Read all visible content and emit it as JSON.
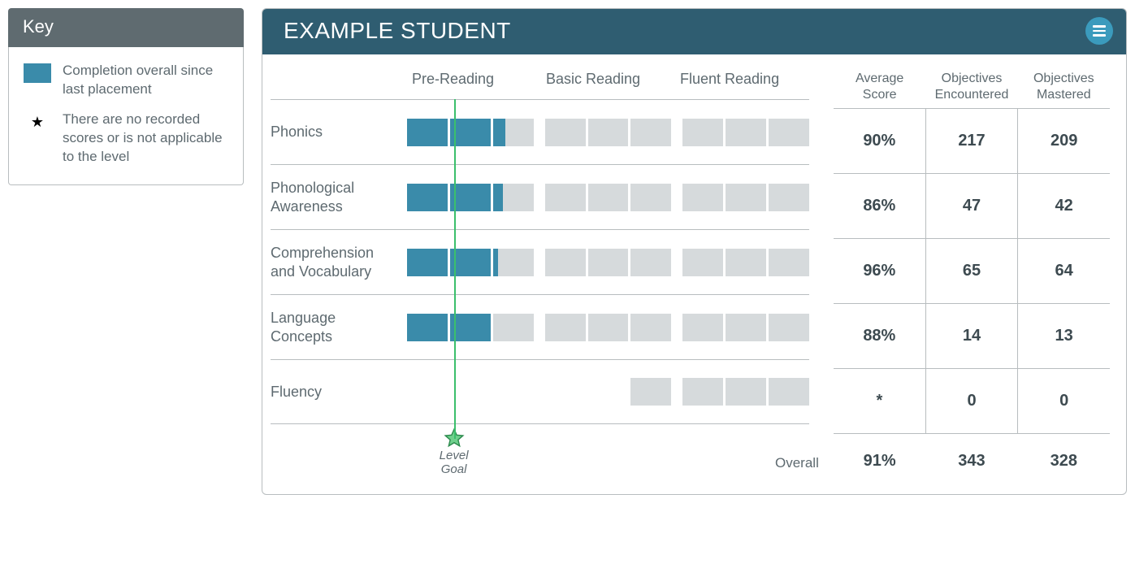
{
  "key": {
    "title": "Key",
    "swatch_text": "Completion overall since last placement",
    "star_text": "There are no recorded scores or is not applicable to the level"
  },
  "header": {
    "student": "EXAMPLE STUDENT"
  },
  "chart": {
    "columns": [
      "Pre-Reading",
      "Basic Reading",
      "Fluent Reading"
    ],
    "goal_label": "Level\nGoal"
  },
  "stats": {
    "headers": [
      "Average Score",
      "Objectives Encountered",
      "Objectives Mastered"
    ],
    "overall_label": "Overall",
    "overall": {
      "avg": "91%",
      "enc": "343",
      "mas": "328"
    }
  },
  "rows": [
    {
      "label": "Phonics",
      "avg": "90%",
      "enc": "217",
      "mas": "209",
      "groups": [
        [
          100,
          100,
          30
        ],
        [
          0,
          0,
          0
        ],
        [
          0,
          0,
          0
        ]
      ]
    },
    {
      "label": "Phonological Awareness",
      "avg": "86%",
      "enc": "47",
      "mas": "42",
      "groups": [
        [
          100,
          100,
          25
        ],
        [
          0,
          0,
          0
        ],
        [
          0,
          0,
          0
        ]
      ]
    },
    {
      "label": "Comprehension and Vocabulary",
      "avg": "96%",
      "enc": "65",
      "mas": "64",
      "groups": [
        [
          100,
          100,
          12
        ],
        [
          0,
          0,
          0
        ],
        [
          0,
          0,
          0
        ]
      ]
    },
    {
      "label": "Language Concepts",
      "avg": "88%",
      "enc": "14",
      "mas": "13",
      "groups": [
        [
          100,
          100,
          0
        ],
        [
          0,
          0,
          0
        ],
        [
          0,
          0,
          0
        ]
      ]
    },
    {
      "label": "Fluency",
      "avg": "*",
      "enc": "0",
      "mas": "0",
      "groups": [
        [
          null,
          null,
          null
        ],
        [
          null,
          null,
          0
        ],
        [
          0,
          0,
          0
        ]
      ]
    }
  ],
  "chart_data": {
    "type": "table",
    "title": "EXAMPLE STUDENT — reading progress by strand",
    "level_columns": [
      "Pre-Reading",
      "Basic Reading",
      "Fluent Reading"
    ],
    "segments_per_level": 3,
    "level_goal_position": {
      "level": "Pre-Reading",
      "fraction": 0.37
    },
    "series": [
      {
        "name": "Phonics",
        "completion_pct": [
          [
            100,
            100,
            30
          ],
          [
            0,
            0,
            0
          ],
          [
            0,
            0,
            0
          ]
        ],
        "avg_score": 90,
        "objectives_encountered": 217,
        "objectives_mastered": 209
      },
      {
        "name": "Phonological Awareness",
        "completion_pct": [
          [
            100,
            100,
            25
          ],
          [
            0,
            0,
            0
          ],
          [
            0,
            0,
            0
          ]
        ],
        "avg_score": 86,
        "objectives_encountered": 47,
        "objectives_mastered": 42
      },
      {
        "name": "Comprehension and Vocabulary",
        "completion_pct": [
          [
            100,
            100,
            12
          ],
          [
            0,
            0,
            0
          ],
          [
            0,
            0,
            0
          ]
        ],
        "avg_score": 96,
        "objectives_encountered": 65,
        "objectives_mastered": 64
      },
      {
        "name": "Language Concepts",
        "completion_pct": [
          [
            100,
            100,
            0
          ],
          [
            0,
            0,
            0
          ],
          [
            0,
            0,
            0
          ]
        ],
        "avg_score": 88,
        "objectives_encountered": 14,
        "objectives_mastered": 13
      },
      {
        "name": "Fluency",
        "completion_pct": [
          [
            null,
            null,
            null
          ],
          [
            null,
            null,
            0
          ],
          [
            0,
            0,
            0
          ]
        ],
        "avg_score": null,
        "objectives_encountered": 0,
        "objectives_mastered": 0
      }
    ],
    "overall": {
      "avg_score": 91,
      "objectives_encountered": 343,
      "objectives_mastered": 328
    }
  }
}
